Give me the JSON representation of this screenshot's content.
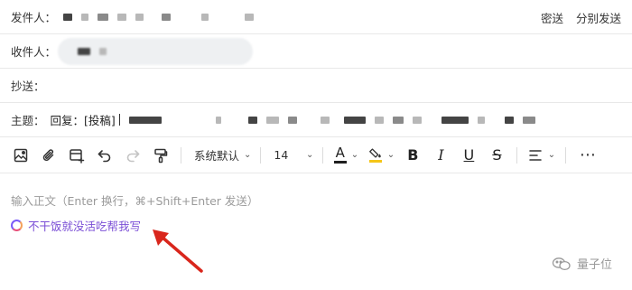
{
  "from": {
    "label": "发件人：",
    "bcc_label": "密送",
    "separate_label": "分别发送"
  },
  "to": {
    "label": "收件人："
  },
  "cc": {
    "label": "抄送："
  },
  "subject": {
    "label": "主题：",
    "value": "回复：[投稿]"
  },
  "toolbar": {
    "font_family": "系统默认",
    "font_size": "14",
    "icons": [
      "image-icon",
      "attachment-icon",
      "card-add-icon",
      "undo-icon",
      "redo-icon",
      "format-painter-icon",
      "font-color-icon",
      "highlight-icon",
      "bold-icon",
      "italic-icon",
      "underline-icon",
      "strikethrough-icon",
      "align-icon",
      "more-icon"
    ],
    "font_color": "#1f1f1f",
    "highlight_color": "#f5c518"
  },
  "editor": {
    "placeholder": "输入正文（Enter 换行，⌘+Shift+Enter 发送）",
    "ai_prompt": "不干饭就没活吃帮我写"
  },
  "annotation": {
    "arrow_color": "#d9261c"
  },
  "watermark": {
    "text": "量子位"
  },
  "colors": {
    "ai_accent": "#7b4fd6",
    "border": "#e8e8e8"
  }
}
